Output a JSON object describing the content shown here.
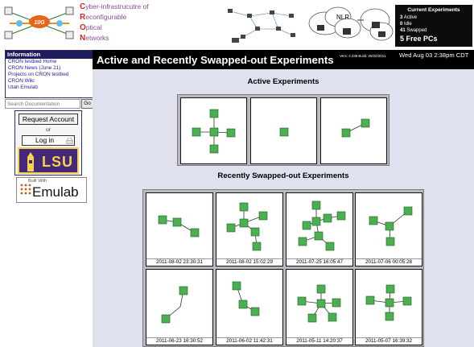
{
  "banner": {
    "cyber_lines": [
      {
        "initial": "C",
        "rest": "yber-infrastrucutre of"
      },
      {
        "initial": "R",
        "rest": "econfigurable"
      },
      {
        "initial": "O",
        "rest": "ptical"
      },
      {
        "initial": "N",
        "rest": "etworks"
      }
    ],
    "logo_label": "10G",
    "cloud_label": "NLR",
    "experiments": {
      "title": "Current Experiments",
      "active": {
        "count": "3",
        "label": "Active"
      },
      "idle": {
        "count": "0",
        "label": "Idle"
      },
      "swapped": {
        "count": "41",
        "label": "Swapped"
      },
      "free_pcs": "5 Free PCs"
    }
  },
  "sidebar": {
    "info_title": "Information",
    "links": [
      "CRON testbed Home",
      "CRON News (June 21)",
      "Projects on CRON testbed",
      "CRON Wiki",
      "Utah Emulab"
    ],
    "search": {
      "placeholder": "Search Documentation",
      "go_label": "Go"
    },
    "request_account": "Request Account",
    "or_text": "or",
    "login": "Log in",
    "lsu": "LSU",
    "built_with": "Built With",
    "emulab": "Emulab"
  },
  "header": {
    "title": "Active and Recently Swapped-out Experiments",
    "version": "Vers: 4.239 Build: 05/20/2011",
    "datetime": "Wed Aug 03 2:38pm CDT"
  },
  "active_heading": "Active Experiments",
  "swapped_heading": "Recently Swapped-out Experiments",
  "swapped_dates": [
    "2011-08-02 23:30:31",
    "2011-08-02 15:02:29",
    "2011-07-25 16:05:47",
    "2011-07-06 00:05:28",
    "2011-06-23 16:30:52",
    "2011-06-02 11:42:31",
    "2011-05-11 14:20:37",
    "2011-05-07 16:39:32"
  ],
  "colors": {
    "header_bg": "#000000",
    "main_bg": "#dfe1ee",
    "node_green": "#4caf50",
    "sidebar_navy": "#1c1c5a"
  }
}
